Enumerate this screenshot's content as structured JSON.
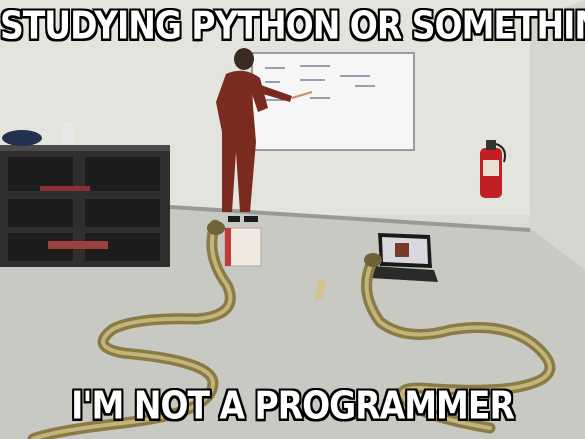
{
  "meme": {
    "top_text": "STUDYING PYTHON OR SOMETHING",
    "bottom_text": "I'M NOT A PROGRAMMER"
  },
  "scene": {
    "subject": "two cobras in a classroom looking at a whiteboard and a laptop"
  }
}
